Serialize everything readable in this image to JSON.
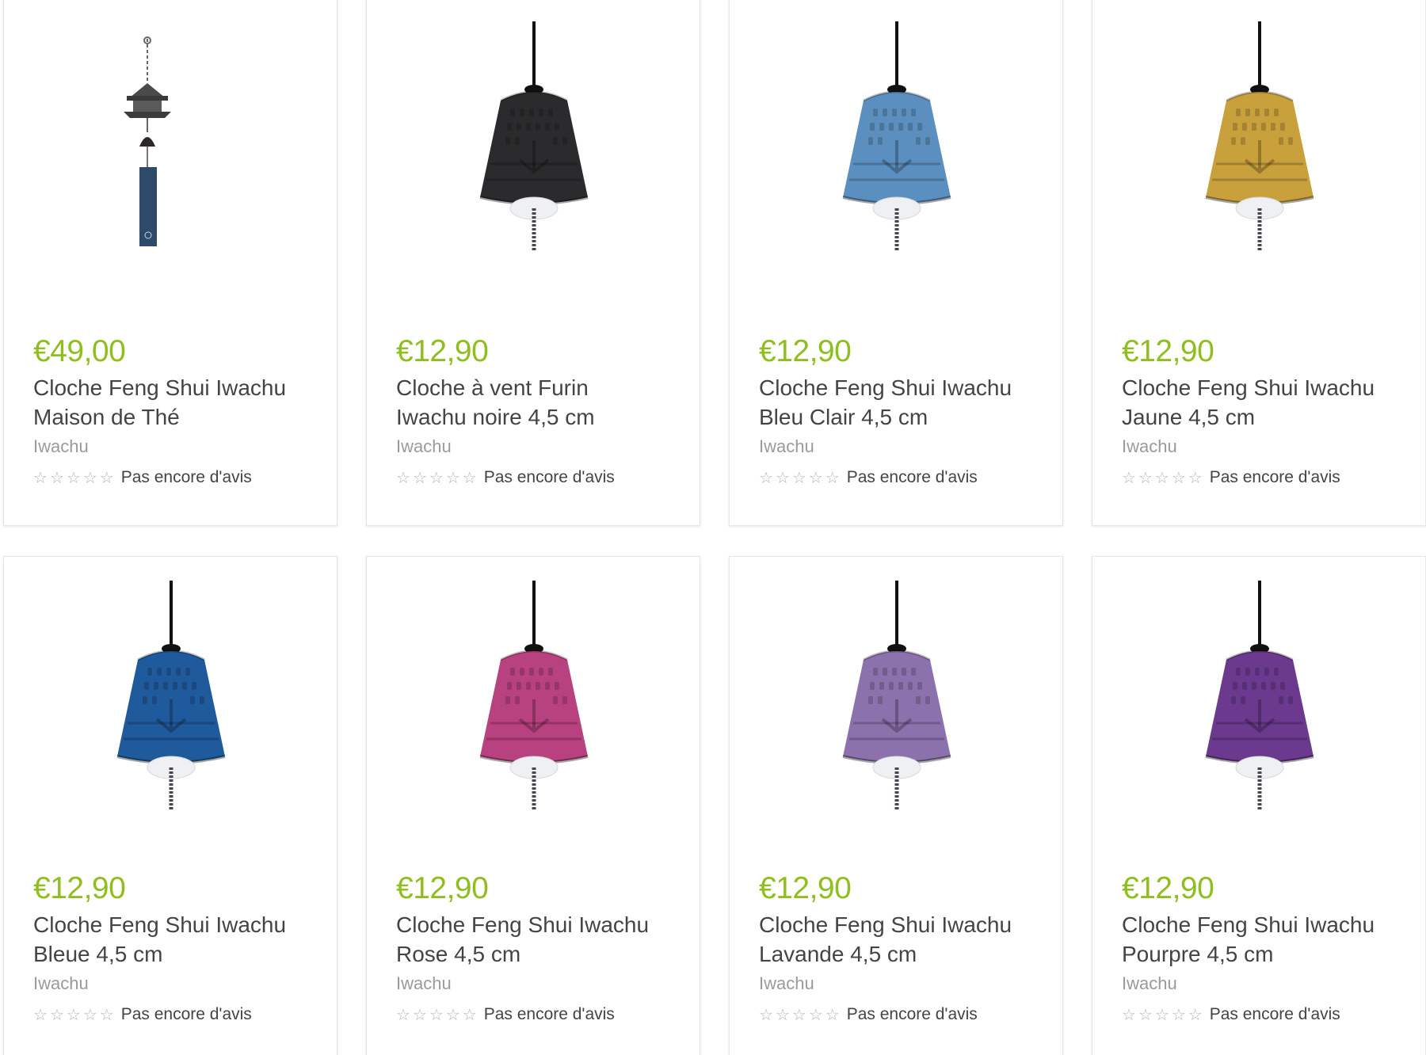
{
  "products": [
    {
      "price": "€49,00",
      "title": "Cloche Feng Shui Iwachu Maison de Thé",
      "brand": "Iwachu",
      "review_text": "Pas encore d'avis",
      "image": "windchime-teahouse",
      "bell_color": "#3a3a3a",
      "rating_stars": 0
    },
    {
      "price": "€12,90",
      "title": "Cloche à vent Furin Iwachu noire 4,5 cm",
      "brand": "Iwachu",
      "review_text": "Pas encore d'avis",
      "image": "bell-black",
      "bell_color": "#2b2b2d",
      "rating_stars": 0
    },
    {
      "price": "€12,90",
      "title": "Cloche Feng Shui Iwachu Bleu Clair 4,5 cm",
      "brand": "Iwachu",
      "review_text": "Pas encore d'avis",
      "image": "bell-light-blue",
      "bell_color": "#5b8fbf",
      "rating_stars": 0
    },
    {
      "price": "€12,90",
      "title": "Cloche Feng Shui Iwachu Jaune 4,5 cm",
      "brand": "Iwachu",
      "review_text": "Pas encore d'avis",
      "image": "bell-yellow",
      "bell_color": "#c9a13c",
      "rating_stars": 0
    },
    {
      "price": "€12,90",
      "title": "Cloche Feng Shui Iwachu Bleue 4,5 cm",
      "brand": "Iwachu",
      "review_text": "Pas encore d'avis",
      "image": "bell-blue",
      "bell_color": "#1f5a9c",
      "rating_stars": 0
    },
    {
      "price": "€12,90",
      "title": "Cloche Feng Shui Iwachu Rose 4,5 cm",
      "brand": "Iwachu",
      "review_text": "Pas encore d'avis",
      "image": "bell-pink",
      "bell_color": "#b8427f",
      "rating_stars": 0
    },
    {
      "price": "€12,90",
      "title": "Cloche Feng Shui Iwachu Lavande 4,5 cm",
      "brand": "Iwachu",
      "review_text": "Pas encore d'avis",
      "image": "bell-lavender",
      "bell_color": "#8b72ad",
      "rating_stars": 0
    },
    {
      "price": "€12,90",
      "title": "Cloche Feng Shui Iwachu Pourpre 4,5 cm",
      "brand": "Iwachu",
      "review_text": "Pas encore d'avis",
      "image": "bell-purple",
      "bell_color": "#6b3a8e",
      "rating_stars": 0
    }
  ],
  "colors": {
    "price": "#8fbf1f",
    "title": "#444444",
    "brand": "#9a9a9a",
    "star_outline": "#b5b5b5"
  }
}
